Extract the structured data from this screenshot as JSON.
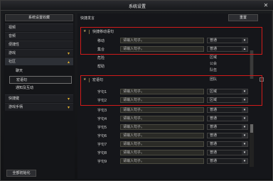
{
  "window": {
    "title": "系统设置"
  },
  "left": {
    "header": "系统设置收藏",
    "items": [
      {
        "label": "视频"
      },
      {
        "label": "音频"
      },
      {
        "label": "便捷性"
      },
      {
        "label": "游戏"
      },
      {
        "label": "社区"
      },
      {
        "label": "快捷键"
      },
      {
        "label": "游戏手柄"
      }
    ],
    "sub_items": [
      {
        "label": "聊天"
      },
      {
        "label": "宏语句"
      },
      {
        "label": "通知及互动"
      }
    ],
    "reset_all": "全部初始化"
  },
  "right": {
    "header": "快捷发言",
    "reset": "重置",
    "section1": {
      "title": "快捷移动语句",
      "rows": [
        {
          "label": "移动",
          "input_placeholder": "请输入句子。",
          "channel": "普通"
        },
        {
          "label": "集合",
          "input_placeholder": "请输入句子。",
          "channel": "普通"
        },
        {
          "label": "危险",
          "channel": "区域"
        },
        {
          "label": "帮助",
          "channel": "公会"
        },
        {
          "label": "",
          "channel": "队伍"
        },
        {
          "label": "",
          "channel": "团队"
        }
      ]
    },
    "section2": {
      "title": "宏语句",
      "rows": [
        {
          "label": "字句1",
          "input_placeholder": "请输入句子。",
          "channel": "区域"
        },
        {
          "label": "字句2",
          "input_placeholder": "请输入句子。",
          "channel": "区域"
        },
        {
          "label": "字句3",
          "input_placeholder": "请输入句子。",
          "channel": "普通"
        },
        {
          "label": "字句4",
          "input_placeholder": "请输入句子。",
          "channel": "普通"
        },
        {
          "label": "字句5",
          "input_placeholder": "请输入句子。",
          "channel": "普通"
        },
        {
          "label": "字句6",
          "input_placeholder": "请输入句子。",
          "channel": "普通"
        },
        {
          "label": "字句7",
          "input_placeholder": "请输入句子。",
          "channel": "普通"
        },
        {
          "label": "字句8",
          "input_placeholder": "请输入句子。",
          "channel": "普通"
        },
        {
          "label": "字句9",
          "input_placeholder": "请输入句子。",
          "channel": "普通"
        }
      ]
    }
  },
  "icons": {
    "close": "close-icon",
    "chevron_down": "chevron-down-icon",
    "chevron_up": "chevron-up-icon",
    "star": "star-icon"
  },
  "colors": {
    "highlight_box": "#d11a1a",
    "accent": "#e0b030"
  }
}
